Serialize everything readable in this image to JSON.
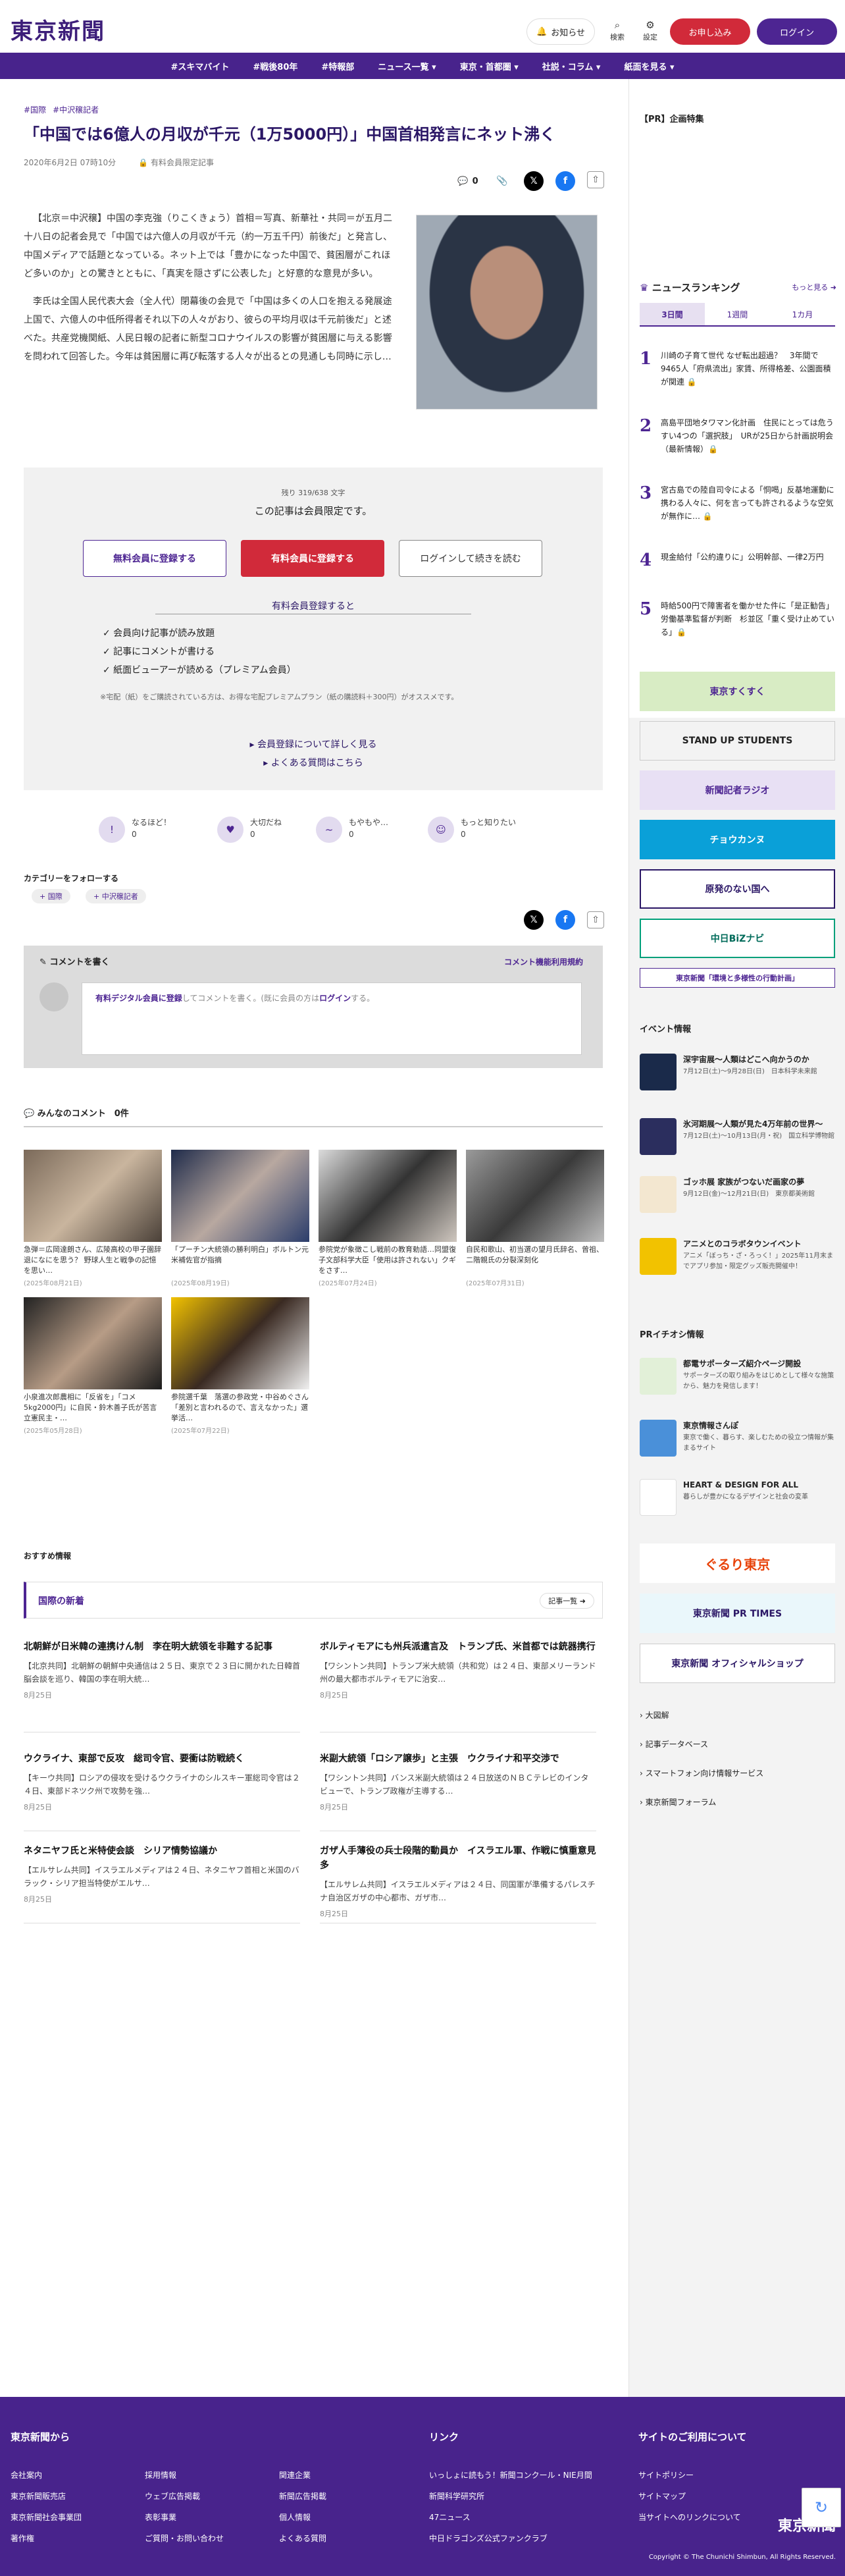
{
  "header": {
    "logo": "東京新聞",
    "notify": "お知らせ",
    "search": "検索",
    "settings": "設定",
    "register": "お申し込み",
    "login": "ログイン"
  },
  "nav": [
    "#スキマバイト",
    "#戦後80年",
    "#特報部",
    "ニュース一覧 ▾",
    "東京・首都圏 ▾",
    "社説・コラム ▾",
    "紙面を見る ▾"
  ],
  "article": {
    "tags": [
      "#国際",
      "#中沢穣記者"
    ],
    "title": "「中国では6億人の月収が千元（1万5000円）」中国首相発言にネット沸く",
    "date": "2020年6月2日 07時10分",
    "members_only": "有料会員限定記事",
    "comment_count": "0",
    "p1": "【北京＝中沢穣】中国の李克強（りこくきょう）首相＝写真、新華社・共同＝が五月二十八日の記者会見で「中国では六億人の月収が千元（約一万五千円）前後だ」と発言し、中国メディアで話題となっている。ネット上では「豊かになった中国で、貧困層がこれほど多いのか」との驚きとともに、「真実を隠さずに公表した」と好意的な意見が多い。",
    "p2": "李氏は全国人民代表大会（全人代）閉幕後の会見で「中国は多くの人口を抱える発展途上国で、六億人の中低所得者それ以下の人々がおり、彼らの平均月収は千元前後だ」と述べた。共産党機関紙、人民日報の記者に新型コロナウイルスの影響が貧困層に与える影響を問われて回答した。今年は貧困層に再び転落する人々が出るとの見通しも同時に示し…"
  },
  "paywall": {
    "remaining": "残り 319/638 文字",
    "limited": "この記事は会員限定です。",
    "free_btn": "無料会員に登録する",
    "paid_btn": "有料会員に登録する",
    "login_btn": "ログインして続きを読む",
    "benefits_title": "有料会員登録すると",
    "benefits": [
      "✓ 会員向け記事が読み放題",
      "✓ 記事にコメントが書ける",
      "✓ 紙面ビューアーが読める（プレミアム会員）"
    ],
    "note": "※宅配（紙）をご購読されている方は、お得な宅配プレミアムプラン（紙の購読料＋300円）がオススメです。",
    "link1": "▸ 会員登録について詳しく見る",
    "link2": "▸ よくある質問はこちら"
  },
  "reactions": [
    {
      "label": "なるほど！",
      "count": "0"
    },
    {
      "label": "大切だね",
      "count": "0"
    },
    {
      "label": "もやもや…",
      "count": "0"
    },
    {
      "label": "もっと知りたい",
      "count": "0"
    }
  ],
  "follow": {
    "title": "カテゴリーをフォローする",
    "chips": [
      "+ 国際",
      "+ 中沢穣記者"
    ]
  },
  "comments": {
    "title": "コメントを書く",
    "rules": "コメント機能利用規約",
    "prompt_link": "有料デジタル会員に登録",
    "prompt_mid": "してコメントを書く。(既に会員の方は",
    "prompt_login": "ログイン",
    "prompt_end": "する。",
    "all": "みんなのコメント　0件"
  },
  "related": [
    {
      "cap": "急弾＝広岡達朗さん、広陵高校の甲子園辞退になにを思う？ 野球人生と戦争の記憶を思い…",
      "date": "(2025年08月21日)"
    },
    {
      "cap": "「プーチン大統領の勝利明白」ボルトン元米補佐官が指摘",
      "date": "(2025年08月19日)"
    },
    {
      "cap": "参院党が象徴こし戦前の教育勅語…同盟復子文部科学大臣「使用は許されない」クギをさす…",
      "date": "(2025年07月24日)"
    },
    {
      "cap": "自民和歌山、初当選の望月氏辞名、曾祖、二階親氏の分裂深刻化",
      "date": "(2025年07月31日)"
    },
    {
      "cap": "小泉進次郎農相に「反省を」「コメ5kg2000円」に自民・鈴木善子氏が苦言　立憲民主・…",
      "date": "(2025年05月28日)"
    },
    {
      "cap": "参院選千葉　落選の参政党・中谷めぐさん「差別と言われるので、言えなかった」選挙活…",
      "date": "(2025年07月22日)"
    }
  ],
  "recommend": "おすすめ情報",
  "section": {
    "title": "国際の新着",
    "more": "記事一覧 ➜"
  },
  "news": [
    {
      "h": "北朝鮮が日米韓の連携けん制　李在明大統領を非難する記事",
      "b": "【北京共同】北朝鮮の朝鮮中央通信は２５日、東京で２３日に開かれた日韓首脳会談を巡り、韓国の李在明大統…",
      "d": "8月25日"
    },
    {
      "h": "ボルティモアにも州兵派遣言及　トランプ氏、米首都では銃器携行",
      "b": "【ワシントン共同】トランプ米大統領（共和党）は２４日、東部メリーランド州の最大都市ボルティモアに治安…",
      "d": "8月25日"
    },
    {
      "h": "ウクライナ、東部で反攻　総司令官、要衝は防戦続く",
      "b": "【キーウ共同】ロシアの侵攻を受けるウクライナのシルスキー軍総司令官は２４日、東部ドネツク州で攻勢を強…",
      "d": "8月25日"
    },
    {
      "h": "米副大統領「ロシア譲歩」と主張　ウクライナ和平交渉で",
      "b": "【ワシントン共同】バンス米副大統領は２４日放送のＮＢＣテレビのインタビューで、トランプ政権が主導する…",
      "d": "8月25日"
    },
    {
      "h": "ネタニヤフ氏と米特使会談　シリア情勢協議か",
      "b": "【エルサレム共同】イスラエルメディアは２４日、ネタニヤフ首相と米国のバラック・シリア担当特使がエルサ…",
      "d": "8月25日"
    },
    {
      "h": "ガザ人手薄役の兵士段階的動員か　イスラエル軍、作戦に慎重意見多",
      "b": "【エルサレム共同】イスラエルメディアは２４日、同国軍が準備するパレスチナ自治区ガザの中心都市、ガザ市…",
      "d": "8月25日"
    }
  ],
  "sidebar": {
    "pr": "【PR】企画特集",
    "ranking_title": "ニュースランキング",
    "ranking_more": "もっと見る ➜",
    "tabs": [
      "3日間",
      "1週間",
      "1カ月"
    ],
    "ranking": [
      "川崎の子育て世代 なぜ転出超過？　3年間で9465人「府県流出」家賃、所得格差、公園面積が関連 🔒",
      "高島平団地タワマン化計画　住民にとっては危うすい4つの「選択肢」　URが25日から計画説明会（最新情報）🔒",
      "宮古島での陸自司令による「恫喝」反基地運動に携わる人々に、何を言っても許されるような空気が無作に… 🔒",
      "現金給付「公約違りに」公明幹部、一律2万円",
      "時給500円で障害者を働かせた件に「是正勧告」労働基準監督が判断　杉並区「重く受け止めている」🔒"
    ],
    "banners": [
      "東京すくすく",
      "STAND UP STUDENTS",
      "新聞記者ラジオ",
      "チョウカンヌ",
      "原発のない国へ",
      "中日BiZナビ",
      "東京新聞「環境と多様性の行動計画」"
    ],
    "events_title": "イベント情報",
    "events": [
      {
        "t": "深宇宙展〜人類はどこへ向かうのか",
        "s": "7月12日(土)〜9月28日(日)　日本科学未来館"
      },
      {
        "t": "氷河期展〜人類が見た4万年前の世界〜",
        "s": "7月12日(土)〜10月13日(月・祝)　国立科学博物館"
      },
      {
        "t": "ゴッホ展 家族がつないだ画家の夢",
        "s": "9月12日(金)〜12月21日(日)　東京都美術館"
      },
      {
        "t": "アニメとのコラボタウンイベント",
        "s": "アニメ「ぼっち・ざ・ろっく！」2025年11月末までアプリ参加・限定グッズ販売開催中！"
      }
    ],
    "pr2_title": "PRイチオシ情報",
    "pr2": [
      {
        "t": "都電サポーターズ紹介ページ開設",
        "s": "サポーターズの取り組みをはじめとして様々な施策から、魅力を発信します！"
      },
      {
        "t": "東京情報さんぽ",
        "s": "東京で働く、暮らす、楽しむための役立つ情報が集まるサイト"
      },
      {
        "t": "HEART & DESIGN FOR ALL",
        "s": "暮らしが豊かになるデザインと社会の変革"
      }
    ],
    "banners2": [
      "ぐるり東京",
      "東京新聞 PR TIMES",
      "東京新聞 オフィシャルショップ"
    ],
    "links": [
      "› 大図解",
      "› 記事データベース",
      "› スマートフォン向け情報サービス",
      "› 東京新聞フォーラム"
    ]
  },
  "footer": {
    "h1": "東京新聞から",
    "h2": "リンク",
    "h3": "サイトのご利用について",
    "col1": [
      "会社案内",
      "東京新聞販売店",
      "東京新聞社会事業団",
      "著作権"
    ],
    "col2": [
      "採用情報",
      "ウェブ広告掲載",
      "表彰事業",
      "ご質問・お問い合わせ"
    ],
    "col3": [
      "関連企業",
      "新聞広告掲載",
      "個人情報",
      "よくある質問"
    ],
    "col4": [
      "いっしょに読もう！新聞コンクール・NIE月間",
      "新聞科学研究所",
      "47ニュース",
      "中日ドラゴンズ公式ファンクラブ"
    ],
    "col5": [
      "サイトポリシー",
      "サイトマップ",
      "当サイトへのリンクについて"
    ],
    "logo": "東京新聞",
    "copy": "Copyright © The Chunichi Shimbun, All Rights Reserved."
  }
}
